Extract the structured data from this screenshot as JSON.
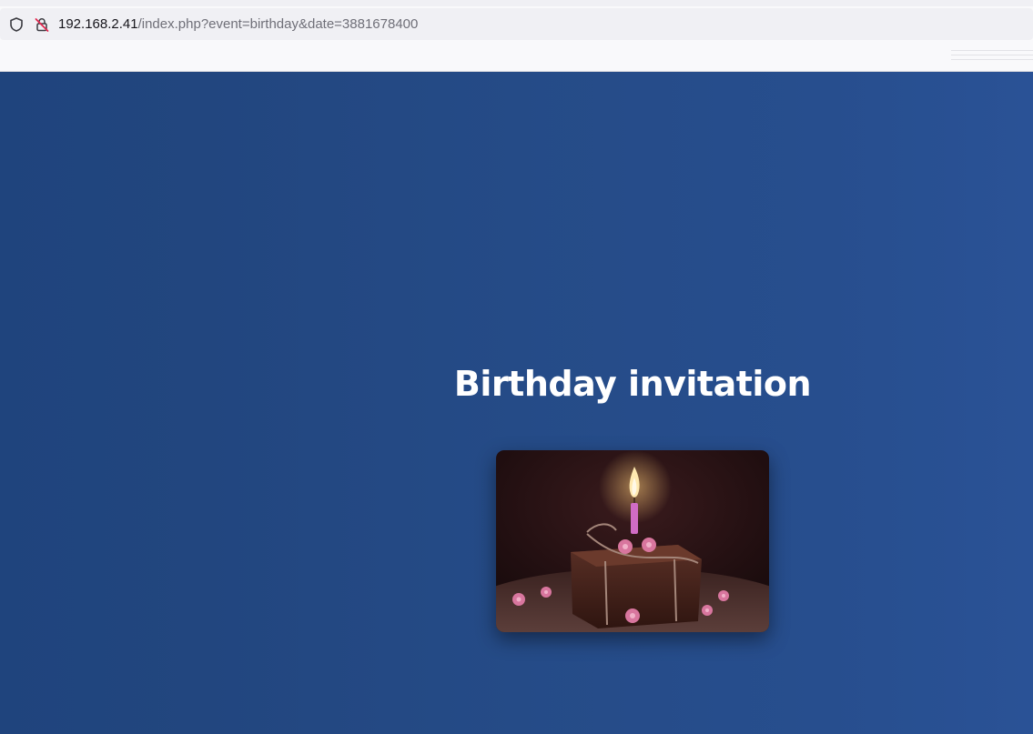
{
  "browser": {
    "url_host": "192.168.2.41",
    "url_path": "/index.php?event=birthday&date=3881678400",
    "icons": [
      "shield-icon",
      "insecure-lock-icon"
    ]
  },
  "page": {
    "title": "Birthday invitation",
    "background_color": "#254b87",
    "image_subject": "birthday-cake-photo"
  }
}
